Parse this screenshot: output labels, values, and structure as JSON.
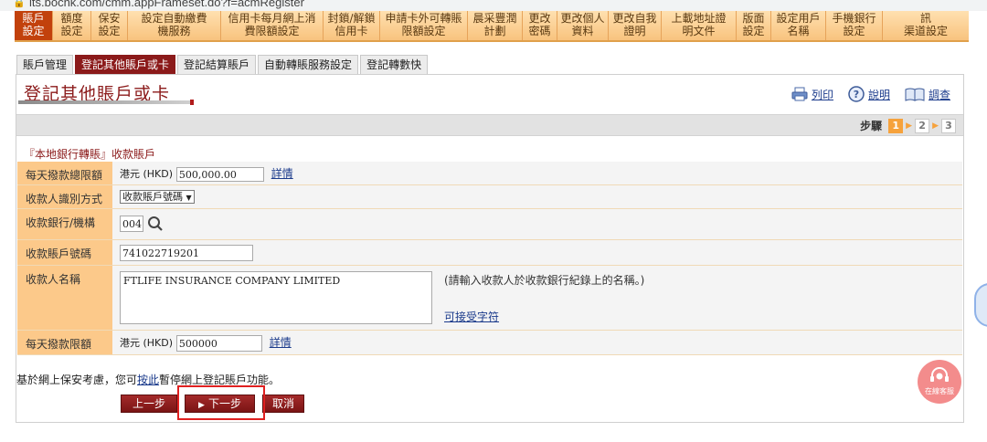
{
  "browser": {
    "url": "its.bochk.com/cmm.appFrameset.do?f=acmRegister"
  },
  "topnav": {
    "items": [
      {
        "label": "賬戶\n設定",
        "active": true
      },
      {
        "label": "額度\n設定"
      },
      {
        "label": "保安\n設定"
      },
      {
        "label": "設定自動繳費\n機服務"
      },
      {
        "label": "信用卡每月網上消\n費限額設定"
      },
      {
        "label": "封鎖/解鎖\n信用卡"
      },
      {
        "label": "申請卡外可轉賬\n限額設定"
      },
      {
        "label": "晨采豐潤\n計劃"
      },
      {
        "label": "更改\n密碼"
      },
      {
        "label": "更改個人\n資料"
      },
      {
        "label": "更改自我\n證明"
      },
      {
        "label": "上載地址證\n明文件"
      },
      {
        "label": "版面\n設定"
      },
      {
        "label": "設定用戶\n名稱"
      },
      {
        "label": "手機銀行\n設定"
      },
      {
        "label": "接收直銷推廣資訊\n渠道設定"
      }
    ]
  },
  "tabs": [
    {
      "label": "賬戶管理"
    },
    {
      "label": "登記其他賬戶或卡",
      "active": true
    },
    {
      "label": "登記結算賬戶"
    },
    {
      "label": "自動轉賬服務設定"
    },
    {
      "label": "登記轉數快"
    }
  ],
  "page": {
    "title": "登記其他賬戶或卡",
    "toolbar": {
      "print": "列印",
      "help": "說明",
      "survey": "調查"
    },
    "steps": {
      "label": "步驟",
      "items": [
        "1",
        "2",
        "3"
      ],
      "current": 1
    },
    "section_title": "『本地銀行轉賬』收款賬戶"
  },
  "form": {
    "daily_limit_total": {
      "label": "每天撥款總限額",
      "currency": "港元 (HKD)",
      "value": "500,000.00",
      "link": "詳情"
    },
    "payee_id_method": {
      "label": "收款人識別方式",
      "selected": "收款賬戶號碼"
    },
    "payee_bank": {
      "label": "收款銀行/機構",
      "value": "004"
    },
    "payee_account": {
      "label": "收款賬戶號碼",
      "value": "741022719201"
    },
    "payee_name": {
      "label": "收款人名稱",
      "value": "FTLIFE INSURANCE COMPANY LIMITED",
      "hint": "(請輸入收款人於收款銀行紀錄上的名稱。)",
      "link": "可接受字符"
    },
    "daily_limit": {
      "label": "每天撥款限額",
      "currency": "港元 (HKD)",
      "value": "500000",
      "link": "詳情"
    }
  },
  "notice": {
    "prefix": "基於網上保安考慮，您可",
    "link": "按此",
    "suffix": "暫停網上登記賬戶功能。"
  },
  "buttons": {
    "prev": "上一步",
    "next": "下一步",
    "cancel": "取消"
  },
  "service": {
    "label": "在線客服"
  },
  "colors": {
    "brand_red": "#8b1a1a",
    "nav_orange": "#f8c37e",
    "label_bg": "#fcc98a",
    "highlight": "#e02020"
  }
}
